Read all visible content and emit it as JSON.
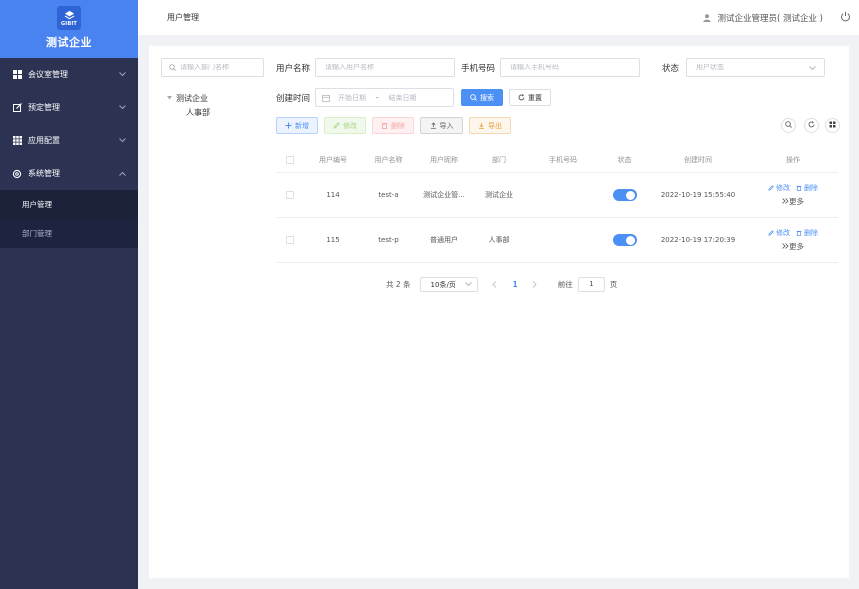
{
  "brand": {
    "logo_text": "GIBIT",
    "title": "测试企业"
  },
  "colors": {
    "primary": "#4c8ff5",
    "sidebar": "#2b3252",
    "brand_bar": "#4983f0"
  },
  "sidebar": {
    "items": [
      {
        "label": "会议室管理",
        "icon": "grid-icon",
        "expanded": false
      },
      {
        "label": "预定管理",
        "icon": "edit-square-icon",
        "expanded": false
      },
      {
        "label": "应用配置",
        "icon": "apps-icon",
        "expanded": false
      },
      {
        "label": "系统管理",
        "icon": "gear-icon",
        "expanded": true
      }
    ],
    "subitems": [
      {
        "label": "用户管理",
        "active": true
      },
      {
        "label": "部门管理",
        "active": false
      }
    ]
  },
  "header": {
    "title": "用户管理",
    "user": "测试企业管理员( 测试企业 )"
  },
  "dept_search": {
    "placeholder": "请输入部门名称"
  },
  "tree": {
    "root": "测试企业",
    "child": "人事部"
  },
  "filters": {
    "username_label": "用户名称",
    "username_placeholder": "请输入用户名称",
    "phone_label": "手机号码",
    "phone_placeholder": "请输入手机号码",
    "status_label": "状态",
    "status_placeholder": "用户状态",
    "created_label": "创建时间",
    "start_placeholder": "开始日期",
    "range_sep": "-",
    "end_placeholder": "结束日期"
  },
  "buttons": {
    "search": "搜索",
    "reset": "重置",
    "add": "新增",
    "edit": "修改",
    "delete": "删除",
    "import": "导入",
    "export": "导出"
  },
  "table": {
    "headers": [
      "用户编号",
      "用户名称",
      "用户昵称",
      "部门",
      "手机号码",
      "状态",
      "创建时间",
      "操作"
    ],
    "rows": [
      {
        "id": "114",
        "name": "test-a",
        "nick": "测试企业管...",
        "dept": "测试企业",
        "phone": "",
        "status_on": true,
        "created": "2022-10-19 15:55:40"
      },
      {
        "id": "115",
        "name": "test-p",
        "nick": "普通用户",
        "dept": "人事部",
        "phone": "",
        "status_on": true,
        "created": "2022-10-19 17:20:39"
      }
    ],
    "op_edit": "修改",
    "op_delete": "删除",
    "op_more": "更多"
  },
  "pager": {
    "total": "共 2 条",
    "page_size": "10条/页",
    "current": "1",
    "goto_label": "前往",
    "goto_value": "1",
    "page_suffix": "页"
  }
}
